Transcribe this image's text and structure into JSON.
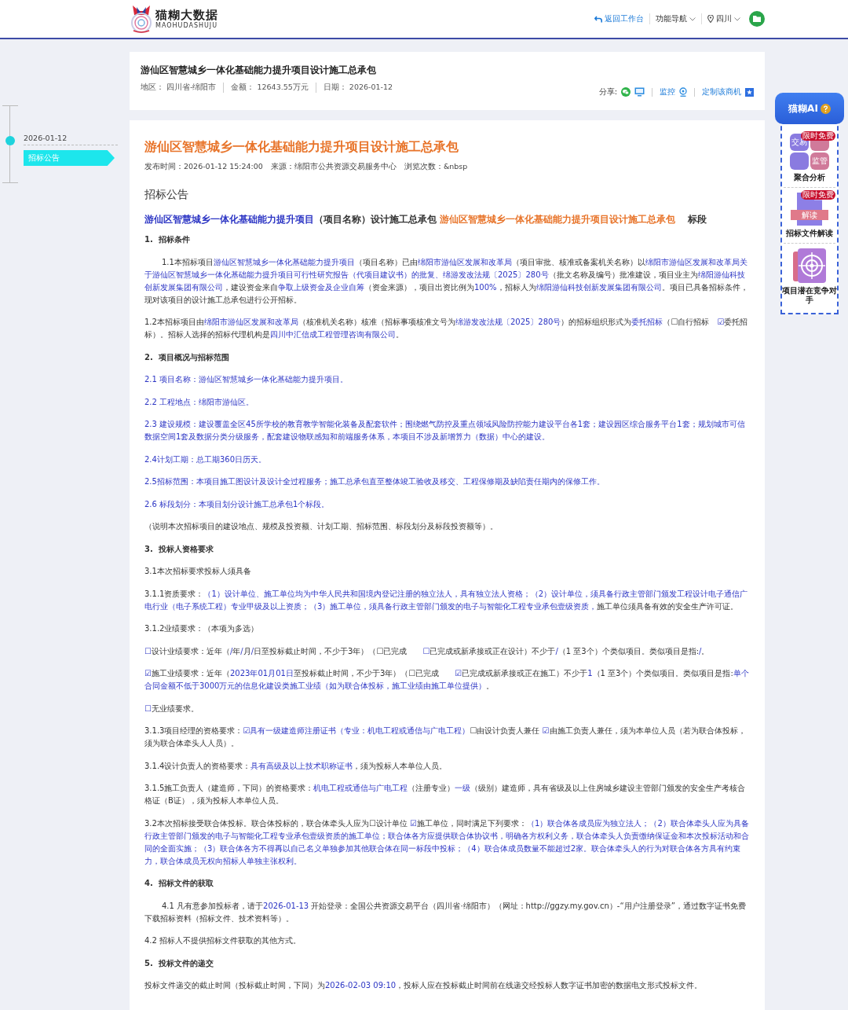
{
  "header": {
    "logo_name": "猫糊大数据",
    "logo_subtitle": "MAOHUDASHUJU",
    "back_link": "返回工作台",
    "nav_menu": "功能导航",
    "region_menu": "四川"
  },
  "summary": {
    "title": "游仙区智慧城乡一体化基础能力提升项目设计施工总承包",
    "meta": [
      "地区： 四川省-绵阳市",
      "金额： 12643.55万元",
      "日期： 2026-01-12"
    ],
    "share_label": "分享:",
    "monitor_link": "监控",
    "subscribe_link": "定制该商机"
  },
  "timeline": {
    "items": [
      {
        "date": "2026-01-12",
        "label": "招标公告",
        "selected": true
      }
    ]
  },
  "ai_panel": {
    "title": "猫糊AI",
    "tools": [
      {
        "kind": "aggregate",
        "label": "聚合分析",
        "badge": "限时免费",
        "tiles": [
          "交易",
          "监管"
        ]
      },
      {
        "kind": "document",
        "label": "招标文件解读",
        "badge": "限时免费",
        "tag": "解读"
      },
      {
        "kind": "target",
        "label": "项目潜在竞争对手"
      }
    ]
  },
  "article": {
    "title": "游仙区智慧城乡一体化基础能力提升项目设计施工总承包",
    "meta": [
      "发布时间：2026-01-12 15:24:00",
      "来源：绵阳市公共资源交易服务中心",
      "浏览次数：&nbsp"
    ],
    "blocks": [
      {
        "kind": "section_title",
        "runs": [
          {
            "text": "招标公告",
            "kind": "plain"
          }
        ]
      },
      {
        "kind": "lead",
        "runs": [
          {
            "text": "游仙区智慧城乡一体化基础能力提升项目",
            "kind": "filled"
          },
          {
            "text": "（项目名称）设计施工总承包 ",
            "kind": "plain"
          },
          {
            "text": "游仙区智慧城乡一体化基础能力提升项目设计施工总承包",
            "kind": "accent"
          },
          {
            "text": "　 标段",
            "kind": "plain"
          }
        ]
      },
      {
        "kind": "heading",
        "runs": [
          {
            "text": "1.  招标条件",
            "kind": "plain"
          }
        ]
      },
      {
        "kind": "indented",
        "runs": [
          {
            "text": "1.1本招标项目",
            "kind": "plain"
          },
          {
            "text": "游仙区智慧城乡一体化基础能力提升项目",
            "kind": "filled"
          },
          {
            "text": "（项目名称）已由",
            "kind": "plain"
          },
          {
            "text": "绵阳市游仙区发展和改革局",
            "kind": "filled"
          },
          {
            "text": "（项目审批、核准或备案机关名称）以",
            "kind": "plain"
          },
          {
            "text": "绵阳市游仙区发展和改革局关于游仙区智慧城乡一体化基础能力提升项目可行性研究报告（代项目建议书）的批复、绵游发改法规〔2025〕280号",
            "kind": "filled"
          },
          {
            "text": "（批文名称及编号）批准建设，项目业主为",
            "kind": "plain"
          },
          {
            "text": "绵阳游仙科技创新发展集团有限公司",
            "kind": "filled"
          },
          {
            "text": "，建设资金来自",
            "kind": "plain"
          },
          {
            "text": "争取上级资金及企业自筹",
            "kind": "filled"
          },
          {
            "text": "（资金来源），项目出资比例为",
            "kind": "plain"
          },
          {
            "text": "100%",
            "kind": "filled"
          },
          {
            "text": "，招标人为",
            "kind": "plain"
          },
          {
            "text": "绵阳游仙科技创新发展集团有限公司",
            "kind": "filled"
          },
          {
            "text": "。项目已具备招标条件，现对该项目的设计施工总承包进行公开招标。",
            "kind": "plain"
          }
        ]
      },
      {
        "kind": "para",
        "runs": [
          {
            "text": "1.2本招标项目由",
            "kind": "plain"
          },
          {
            "text": "绵阳市游仙区发展和改革局",
            "kind": "filled"
          },
          {
            "text": "（核准机关名称）核准（招标事项核准文号为",
            "kind": "plain"
          },
          {
            "text": "绵游发改法规〔2025〕280号",
            "kind": "filled"
          },
          {
            "text": "）的招标组织形式为",
            "kind": "plain"
          },
          {
            "text": "委托招标",
            "kind": "filled"
          },
          {
            "text": "（☐自行招标　",
            "kind": "plain"
          },
          {
            "text": "☑",
            "kind": "filled"
          },
          {
            "text": "委托招标）。招标人选择的招标代理机构是",
            "kind": "plain"
          },
          {
            "text": "四川中汇信成工程管理咨询有限公司",
            "kind": "filled"
          },
          {
            "text": "。",
            "kind": "plain"
          }
        ]
      },
      {
        "kind": "heading",
        "runs": [
          {
            "text": "2.  项目概况与招标范围",
            "kind": "plain"
          }
        ]
      },
      {
        "kind": "para",
        "runs": [
          {
            "text": "2.1 项目名称：游仙区智慧城乡一体化基础能力提升项目。",
            "kind": "filled"
          }
        ]
      },
      {
        "kind": "para",
        "runs": [
          {
            "text": "2.2 工程地点：绵阳市游仙区。",
            "kind": "filled"
          }
        ]
      },
      {
        "kind": "para",
        "runs": [
          {
            "text": "2.3 建设规模：建设覆盖全区45所学校的教育教学智能化装备及配套软件；围绕燃气防控及重点领域风险防控能力建设平台各1套；建设园区综合服务平台1套；规划城市可信数据空间1套及数据分类分级服务，配套建设物联感知和前端服务体系，本项目不涉及新增算力（数据）中心的建设。",
            "kind": "filled"
          }
        ]
      },
      {
        "kind": "para",
        "runs": [
          {
            "text": "2.4计划工期：总工期360日历天。",
            "kind": "filled"
          }
        ]
      },
      {
        "kind": "para",
        "runs": [
          {
            "text": "2.5招标范围：本项目施工图设计及设计全过程服务；施工总承包直至整体竣工验收及移交、工程保修期及缺陷责任期内的保修工作。",
            "kind": "filled"
          }
        ]
      },
      {
        "kind": "para",
        "runs": [
          {
            "text": "2.6 标段划分：本项目划分设计施工总承包1个标段。",
            "kind": "filled"
          }
        ]
      },
      {
        "kind": "para",
        "runs": [
          {
            "text": "（说明本次招标项目的建设地点、规模及投资额、计划工期、招标范围、标段划分及标段投资额等）。",
            "kind": "plain"
          }
        ]
      },
      {
        "kind": "heading",
        "runs": [
          {
            "text": "3.  投标人资格要求",
            "kind": "plain"
          }
        ]
      },
      {
        "kind": "para",
        "runs": [
          {
            "text": "3.1本次招标要求投标人须具备",
            "kind": "plain"
          }
        ]
      },
      {
        "kind": "para",
        "runs": [
          {
            "text": "3.1.1资质要求：",
            "kind": "plain"
          },
          {
            "text": "（1）设计单位、施工单位均为中华人民共和国境内登记注册的独立法人，具有独立法人资格；（2）设计单位，须具备行政主管部门颁发工程设计电子通信广电行业（电子系统工程）专业甲级及以上资质；（3）施工单位，须具备行政主管部门颁发的电子与智能化工程专业承包壹级资质，",
            "kind": "filled"
          },
          {
            "text": "施工单位须具备有效的安全生产许可证。",
            "kind": "plain"
          }
        ]
      },
      {
        "kind": "para",
        "runs": [
          {
            "text": "3.1.2业绩要求：（本项为多选）",
            "kind": "plain"
          }
        ]
      },
      {
        "kind": "para",
        "runs": [
          {
            "text": "☐",
            "kind": "filled"
          },
          {
            "text": "设计业绩要求：近年（",
            "kind": "plain"
          },
          {
            "text": "/",
            "kind": "filled"
          },
          {
            "text": "年",
            "kind": "plain"
          },
          {
            "text": "/",
            "kind": "filled"
          },
          {
            "text": "月",
            "kind": "plain"
          },
          {
            "text": "/",
            "kind": "filled"
          },
          {
            "text": "日至投标截止时间，不少于3年）（☐已完成　　",
            "kind": "plain"
          },
          {
            "text": "☐",
            "kind": "filled"
          },
          {
            "text": "已完成或新承接或正在设计）不少于",
            "kind": "plain"
          },
          {
            "text": "/",
            "kind": "filled"
          },
          {
            "text": "（1 至3个）个类似项目。类似项目是指:",
            "kind": "plain"
          },
          {
            "text": "/",
            "kind": "filled"
          },
          {
            "text": "。",
            "kind": "plain"
          }
        ]
      },
      {
        "kind": "para",
        "runs": [
          {
            "text": "☑",
            "kind": "filled"
          },
          {
            "text": "施工业绩要求：近年（",
            "kind": "plain"
          },
          {
            "text": "2023年01月01日",
            "kind": "filled"
          },
          {
            "text": "至投标截止时间，不少于3年）（☐已完成　　",
            "kind": "plain"
          },
          {
            "text": "☑",
            "kind": "filled"
          },
          {
            "text": "已完成或新承接或正在施工）不少于",
            "kind": "plain"
          },
          {
            "text": "1",
            "kind": "filled"
          },
          {
            "text": "（1 至3个）个类似项目。类似项目是指:",
            "kind": "plain"
          },
          {
            "text": "单个合同金额不低于3000万元的信息化建设类施工业绩（如为联合体投标，施工业绩由施工单位提供）",
            "kind": "filled"
          },
          {
            "text": "。",
            "kind": "plain"
          }
        ]
      },
      {
        "kind": "para",
        "runs": [
          {
            "text": "☐",
            "kind": "filled"
          },
          {
            "text": "无业绩要求。",
            "kind": "plain"
          }
        ]
      },
      {
        "kind": "para",
        "runs": [
          {
            "text": "3.1.3项目经理的资格要求：",
            "kind": "plain"
          },
          {
            "text": "☑具有一级建造师注册证书（专业：机电工程或通信与广电工程）",
            "kind": "filled"
          },
          {
            "text": "☐由设计负责人兼任 ",
            "kind": "plain"
          },
          {
            "text": "☑",
            "kind": "filled"
          },
          {
            "text": "由施工负责人兼任，须为本单位人员（若为联合体投标，须为联合体牵头人人员）。",
            "kind": "plain"
          }
        ]
      },
      {
        "kind": "para",
        "runs": [
          {
            "text": "3.1.4设计负责人的资格要求：",
            "kind": "plain"
          },
          {
            "text": "具有高级及以上技术职称证书",
            "kind": "filled"
          },
          {
            "text": "，须为投标人本单位人员。",
            "kind": "plain"
          }
        ]
      },
      {
        "kind": "para",
        "runs": [
          {
            "text": "3.1.5施工负责人（建造师，下同）的资格要求：",
            "kind": "plain"
          },
          {
            "text": "机电工程或通信与广电工程",
            "kind": "filled"
          },
          {
            "text": "（注册专业）",
            "kind": "plain"
          },
          {
            "text": "一级",
            "kind": "filled"
          },
          {
            "text": "（级别）建造师，具有省级及以上住房城乡建设主管部门颁发的安全生产考核合格证（B证），须为投标人本单位人员。",
            "kind": "plain"
          }
        ]
      },
      {
        "kind": "para",
        "runs": [
          {
            "text": "3.2本次招标接受联合体投标。联合体投标的，联合体牵头人应为☐设计单位 ",
            "kind": "plain"
          },
          {
            "text": "☑",
            "kind": "filled"
          },
          {
            "text": "施工单位，同时满足下列要求：",
            "kind": "plain"
          },
          {
            "text": "（1）联合体各成员应为独立法人；（2）联合体牵头人应为具备行政主管部门颁发的电子与智能化工程专业承包壹级资质的施工单位；联合体各方应提供联合体协议书，明确各方权利义务，联合体牵头人负责缴纳保证金和本次投标活动和合同的全面实施；（3）联合体各方不得再以自己名义单独参加其他联合体在同一标段中投标；（4）联合体成员数量不能超过2家。联合体牵头人的行为对联合体各方具有约束力，联合体成员无权向招标人单独主张权利。",
            "kind": "filled"
          }
        ]
      },
      {
        "kind": "heading",
        "runs": [
          {
            "text": "4.  招标文件的获取",
            "kind": "plain"
          }
        ]
      },
      {
        "kind": "indented",
        "runs": [
          {
            "text": "4.1 凡有意参加投标者，请于",
            "kind": "plain"
          },
          {
            "text": "2026-01-13",
            "kind": "filled"
          },
          {
            "text": " 开始登录：全国公共资源交易平台（四川省·绵阳市）（网址：http://ggzy.my.gov.cn）-“用户注册登录”，通过数字证书免费下载招标资料（招标文件、技术资料等）。",
            "kind": "plain"
          }
        ]
      },
      {
        "kind": "para",
        "runs": [
          {
            "text": "4.2 招标人不提供招标文件获取的其他方式。",
            "kind": "plain"
          }
        ]
      },
      {
        "kind": "heading",
        "runs": [
          {
            "text": "5.  投标文件的递交",
            "kind": "plain"
          }
        ]
      },
      {
        "kind": "para",
        "runs": [
          {
            "text": "投标文件递交的截止时间（投标截止时间，下同）为",
            "kind": "plain"
          },
          {
            "text": "2026-02-03 09:10",
            "kind": "filled"
          },
          {
            "text": "，投标人应在投标截止时间前在线递交经投标人数字证书加密的数据电文形式投标文件。",
            "kind": "plain"
          }
        ]
      }
    ]
  }
}
